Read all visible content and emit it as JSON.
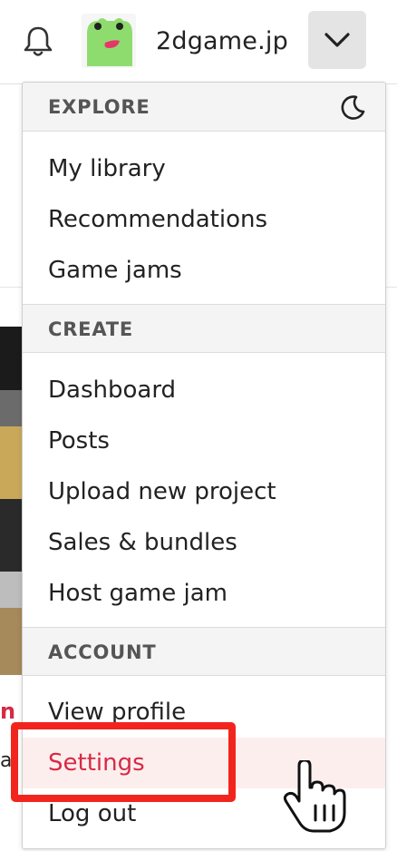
{
  "header": {
    "username": "2dgame.jp",
    "icons": {
      "notifications": "bell-icon",
      "avatar": "frog-avatar",
      "menu_toggle": "chevron-down-icon"
    }
  },
  "menu": {
    "sections": [
      {
        "title": "EXPLORE",
        "icon": "moon-icon",
        "items": [
          "My library",
          "Recommendations",
          "Game jams"
        ]
      },
      {
        "title": "CREATE",
        "items": [
          "Dashboard",
          "Posts",
          "Upload new project",
          "Sales & bundles",
          "Host game jam"
        ]
      },
      {
        "title": "ACCOUNT",
        "items": [
          "View profile",
          "Settings",
          "Log out"
        ]
      }
    ],
    "active_item": "Settings"
  },
  "background": {
    "partial_text_red": "n",
    "partial_text_dark": "a"
  },
  "colors": {
    "accent": "#d72a44",
    "active_row_bg": "#fdeeee",
    "highlight_annotation": "#f2251e",
    "section_bg": "#f4f4f4"
  }
}
